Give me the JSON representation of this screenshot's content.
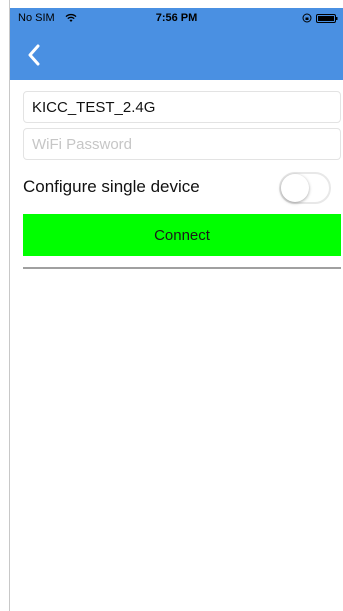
{
  "status_bar": {
    "carrier": "No SIM",
    "time": "7:56 PM"
  },
  "header": {
    "back_icon": "chevron-left-icon",
    "background_color": "#4a90e2"
  },
  "form": {
    "ssid_value": "KICC_TEST_2.4G",
    "password_value": "",
    "password_placeholder": "WiFi Password",
    "single_device_label": "Configure single device",
    "single_device_enabled": false,
    "connect_label": "Connect",
    "connect_color": "#00ff00"
  }
}
